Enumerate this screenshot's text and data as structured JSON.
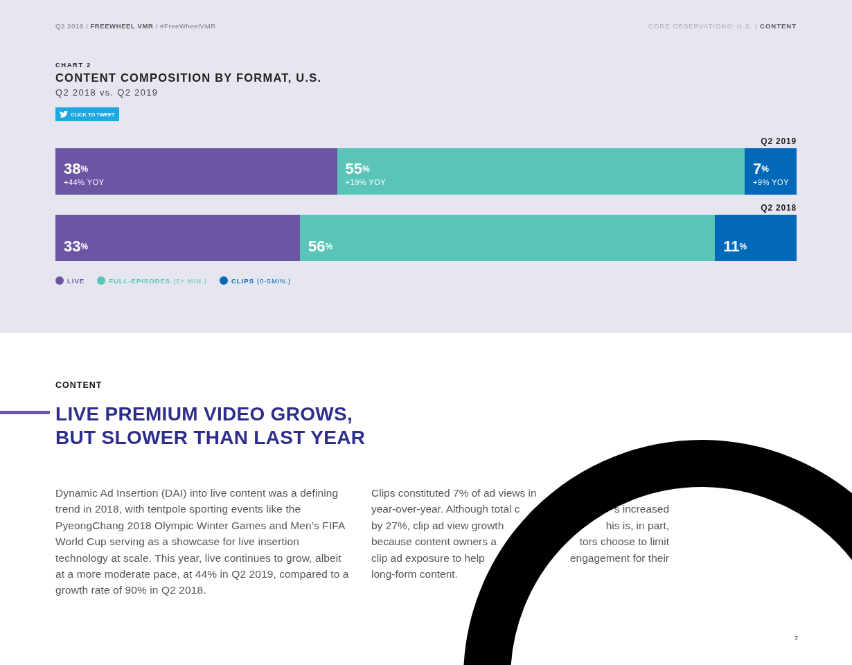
{
  "header": {
    "left": {
      "period": "Q2 2019 / ",
      "brand": "FREEWHEEL VMR",
      "tag": " / #FreeWheelVMR"
    },
    "right": {
      "section": "CORE OBSERVATIONS: U.S.",
      "divider": "|",
      "page": "CONTENT"
    }
  },
  "chart": {
    "eyebrow": "CHART 2",
    "title": "CONTENT COMPOSITION BY FORMAT, U.S.",
    "subtitle": "Q2 2018 vs. Q2 2019",
    "tweet_button": "CLICK TO TWEET",
    "rows": [
      {
        "label": "Q2 2019",
        "segments": [
          {
            "value": "38",
            "unit": "%",
            "yoy": "+44% YOY",
            "color": "#6c55a3"
          },
          {
            "value": "55",
            "unit": "%",
            "yoy": "+19% YOY",
            "color": "#5bc4b8"
          },
          {
            "value": "7",
            "unit": "%",
            "yoy": "+9% YOY",
            "color": "#0169b8"
          }
        ]
      },
      {
        "label": "Q2 2018",
        "segments": [
          {
            "value": "33",
            "unit": "%",
            "color": "#6c55a3"
          },
          {
            "value": "56",
            "unit": "%",
            "color": "#5bc4b8"
          },
          {
            "value": "11",
            "unit": "%",
            "color": "#0169b8"
          }
        ]
      }
    ],
    "legend": [
      {
        "name": "LIVE",
        "color": "#6c55a3"
      },
      {
        "name": "FULL-EPISODES",
        "note": "(5+ MIN.)",
        "color": "#5bc4b8"
      },
      {
        "name": "CLIPS",
        "note": "(0-5MIN.)",
        "color": "#0169b8"
      }
    ]
  },
  "article": {
    "eyebrow": "CONTENT",
    "headline": [
      "LIVE PREMIUM VIDEO GROWS,",
      "BUT SLOWER THAN LAST YEAR"
    ],
    "left_paragraph": "Dynamic Ad Insertion (DAI) into live content was a defining trend in 2018, with tentpole sporting events like the PyeongChang 2018 Olympic Winter Games and Men’s FIFA World Cup serving as a showcase for live insertion technology at scale. This year, live continues to grow, albeit at a more moderate pace, at 44% in Q2 2019, compared to a growth rate of 90% in Q2 2018.",
    "right_paragraph_lines": [
      [
        "Clips constituted 7% of ad views in"
      ],
      [
        "year-over-year. Although total c",
        "s increased"
      ],
      [
        "by 27%, clip ad view growth",
        "his is, in part,"
      ],
      [
        "because content owners a",
        "tors choose to limit"
      ],
      [
        "clip ad exposure to help",
        "engagement for their"
      ],
      [
        "long-form content."
      ]
    ]
  },
  "page_number": "7"
}
